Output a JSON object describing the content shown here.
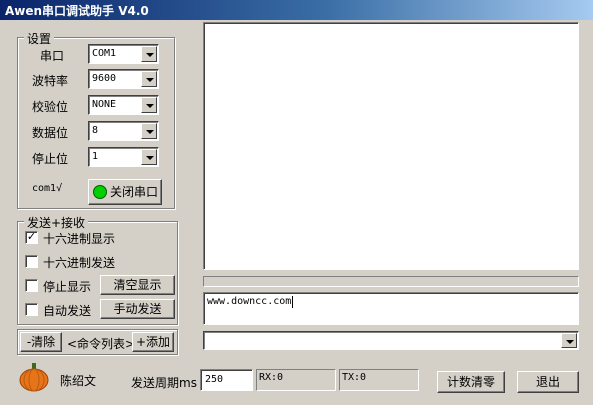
{
  "window": {
    "title": "Awen串口调试助手 V4.0"
  },
  "settings": {
    "group_title": "设置",
    "port_label": "串口",
    "port_value": "COM1",
    "baud_label": "波特率",
    "baud_value": "9600",
    "parity_label": "校验位",
    "parity_value": "NONE",
    "databits_label": "数据位",
    "databits_value": "8",
    "stopbits_label": "停止位",
    "stopbits_value": "1",
    "status_text": "com1√",
    "led_color": "#00d000",
    "close_port_label": "关闭串口"
  },
  "sendrecv": {
    "group_title": "发送+接收",
    "hex_display_label": "十六进制显示",
    "hex_display_checked": "✓",
    "hex_send_label": "十六进制发送",
    "stop_display_label": "停止显示",
    "auto_send_label": "自动发送",
    "clear_display_label": "清空显示",
    "manual_send_label": "手动发送"
  },
  "commands": {
    "clear_label": "-清除",
    "list_label": "<命令列表>",
    "add_label": "+添加"
  },
  "send_input": {
    "value": "www.downcc.com"
  },
  "footer": {
    "author": "陈绍文",
    "period_label": "发送周期ms",
    "period_value": "250",
    "rx_label": "RX:0",
    "tx_label": "TX:0",
    "reset_count_label": "计数清零",
    "exit_label": "退出"
  }
}
